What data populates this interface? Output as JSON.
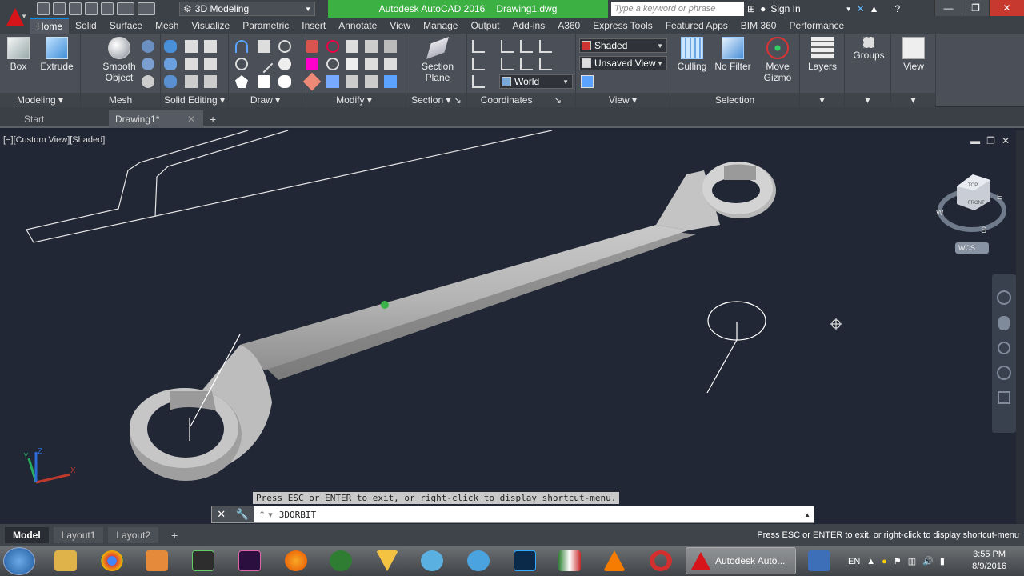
{
  "titlebar": {
    "workspace": "3D Modeling",
    "app_name": "Autodesk AutoCAD 2016",
    "file_name": "Drawing1.dwg",
    "search_placeholder": "Type a keyword or phrase",
    "sign_in": "Sign In"
  },
  "ribbon_tabs": [
    "Home",
    "Solid",
    "Surface",
    "Mesh",
    "Visualize",
    "Parametric",
    "Insert",
    "Annotate",
    "View",
    "Manage",
    "Output",
    "Add-ins",
    "A360",
    "Express Tools",
    "Featured Apps",
    "BIM 360",
    "Performance"
  ],
  "ribbon": {
    "box": "Box",
    "extrude": "Extrude",
    "smooth_object": "Smooth Object",
    "section_plane": "Section Plane",
    "culling": "Culling",
    "no_filter": "No Filter",
    "move_gizmo": "Move Gizmo",
    "layers": "Layers",
    "groups": "Groups",
    "view": "View",
    "visual_style": "Shaded",
    "saved_view": "Unsaved View",
    "ucs": "World",
    "panels": {
      "modeling": "Modeling",
      "mesh": "Mesh",
      "solid_editing": "Solid Editing",
      "draw": "Draw",
      "modify": "Modify",
      "section": "Section",
      "coordinates": "Coordinates",
      "view": "View",
      "selection": "Selection"
    }
  },
  "doc_tabs": {
    "start": "Start",
    "drawing": "Drawing1*"
  },
  "viewport": {
    "label": "[−][Custom View][Shaded]",
    "viewcube": {
      "top": "TOP",
      "front": "FRONT",
      "n": "E",
      "w": "W",
      "s": "S",
      "wcs": "WCS"
    },
    "axis": {
      "x": "X",
      "y": "Y",
      "z": "Z"
    }
  },
  "command": {
    "hint": "Press ESC or ENTER to exit, or right-click to display shortcut-menu.",
    "value": "3DORBIT"
  },
  "layout_tabs": [
    "Model",
    "Layout1",
    "Layout2"
  ],
  "status_message": "Press ESC or ENTER to exit, or right-click to display shortcut-menu",
  "taskbar": {
    "active_app": "Autodesk Auto...",
    "lang": "EN",
    "time": "3:55 PM",
    "date": "8/9/2016"
  }
}
